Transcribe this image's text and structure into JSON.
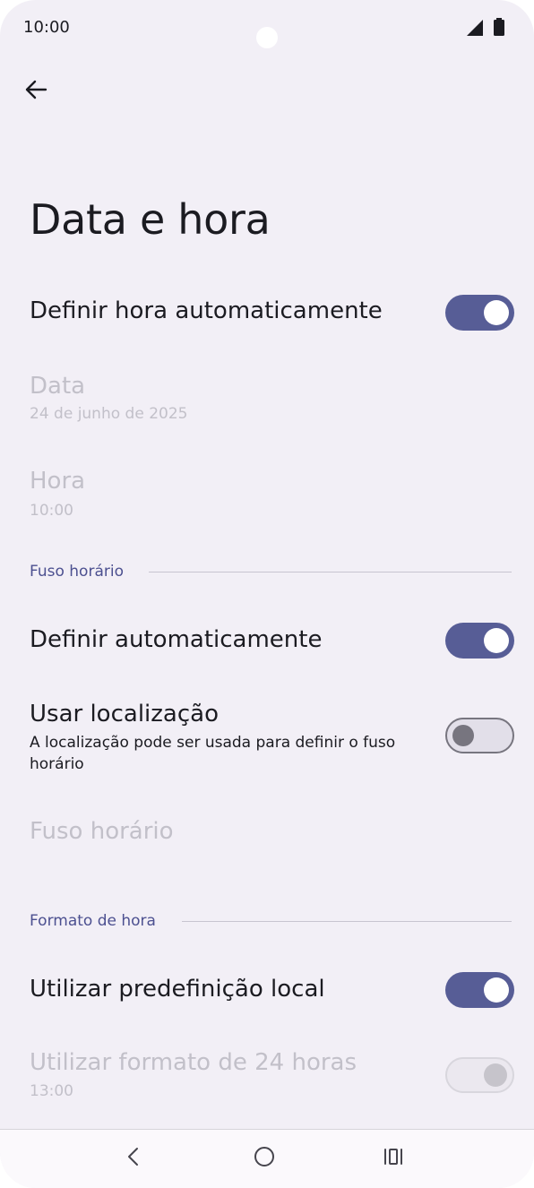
{
  "status_bar": {
    "time": "10:00",
    "icons": [
      "signal-icon",
      "battery-icon"
    ]
  },
  "header": {
    "back_icon": "arrow-left-icon",
    "title": "Data e hora"
  },
  "settings": {
    "auto_time": {
      "label": "Definir hora automaticamente",
      "enabled": true
    },
    "date": {
      "label": "Data",
      "value": "24 de junho de 2025"
    },
    "time": {
      "label": "Hora",
      "value": "10:00"
    }
  },
  "timezone_section": {
    "header": "Fuso horário",
    "auto": {
      "label": "Definir automaticamente",
      "enabled": true
    },
    "use_location": {
      "label": "Usar localização",
      "description": "A localização pode ser usada para definir o fuso horário",
      "enabled": false
    },
    "timezone": {
      "label": "Fuso horário"
    }
  },
  "format_section": {
    "header": "Formato de hora",
    "locale_default": {
      "label": "Utilizar predefinição local",
      "enabled": true
    },
    "format_24h": {
      "label": "Utilizar formato de 24 horas",
      "value": "13:00",
      "enabled": true
    }
  },
  "nav_bar": {
    "icons": [
      "back-chevron-icon",
      "home-circle-icon",
      "recents-icon"
    ]
  },
  "colors": {
    "background": "#f2eff6",
    "accent": "#575d96",
    "section_header": "#4c5090",
    "disabled_text": "#c2c0c9"
  }
}
